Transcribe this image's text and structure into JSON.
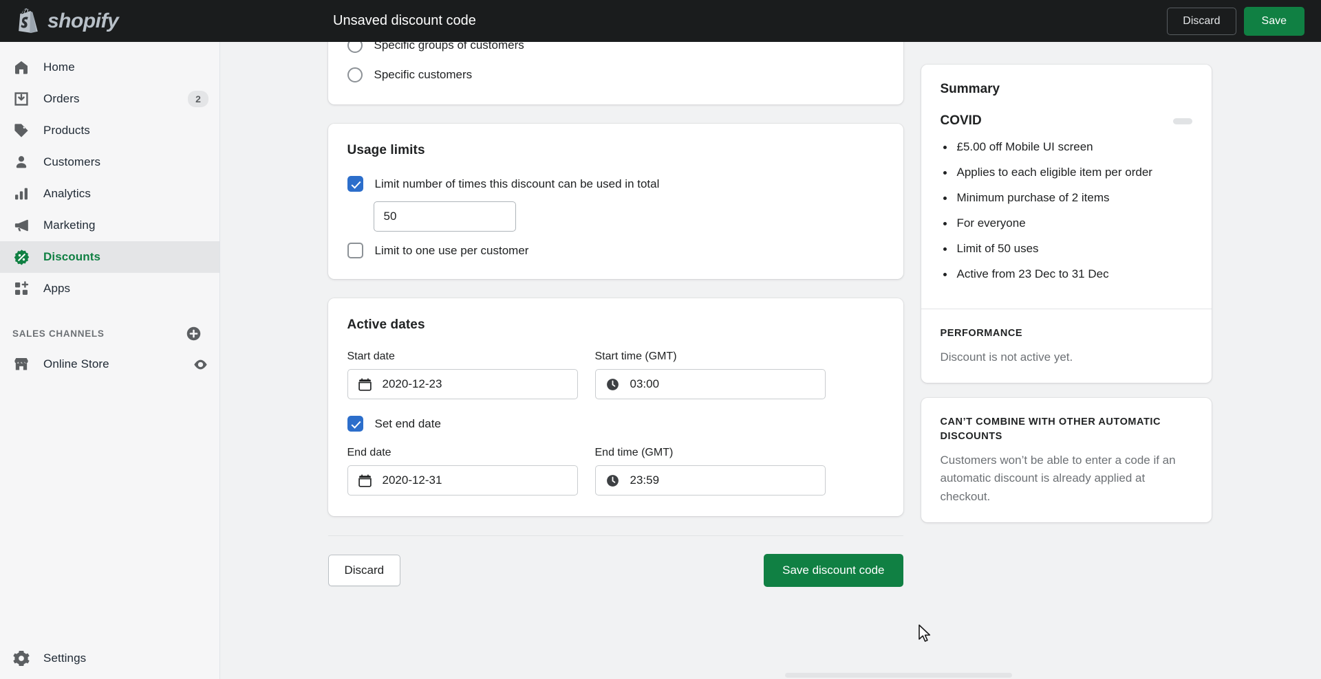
{
  "topbar": {
    "brand": "shopify",
    "brand_icon": "shopify-bag-logo",
    "title": "Unsaved discount code",
    "discard_label": "Discard",
    "save_label": "Save",
    "accent_green": "#108043",
    "background": "#1a1c1d"
  },
  "sidebar": {
    "items": [
      {
        "label": "Home",
        "icon": "home-icon",
        "badge": "",
        "active": false
      },
      {
        "label": "Orders",
        "icon": "orders-icon",
        "badge": "2",
        "active": false
      },
      {
        "label": "Products",
        "icon": "products-icon",
        "badge": "",
        "active": false
      },
      {
        "label": "Customers",
        "icon": "customers-icon",
        "badge": "",
        "active": false
      },
      {
        "label": "Analytics",
        "icon": "analytics-icon",
        "badge": "",
        "active": false
      },
      {
        "label": "Marketing",
        "icon": "marketing-icon",
        "badge": "",
        "active": false
      },
      {
        "label": "Discounts",
        "icon": "discounts-icon",
        "badge": "",
        "active": true
      },
      {
        "label": "Apps",
        "icon": "apps-icon",
        "badge": "",
        "active": false
      }
    ],
    "sales_channels": {
      "title": "SALES CHANNELS",
      "add_icon": "plus-circle-icon",
      "channels": [
        {
          "label": "Online Store",
          "icon": "store-icon",
          "action_icon": "eye-icon"
        }
      ]
    },
    "settings": {
      "label": "Settings",
      "icon": "gear-icon"
    },
    "active_color": "#108043"
  },
  "eligibility_card": {
    "options": [
      {
        "label": "Specific groups of customers",
        "selected": false
      },
      {
        "label": "Specific customers",
        "selected": false
      }
    ]
  },
  "usage_limits": {
    "title": "Usage limits",
    "limit_total": {
      "label": "Limit number of times this discount can be used in total",
      "checked": true,
      "value": "50",
      "placeholder": ""
    },
    "limit_per_customer": {
      "label": "Limit to one use per customer",
      "checked": false
    }
  },
  "active_dates": {
    "title": "Active dates",
    "start_date": {
      "label": "Start date",
      "value": "2020-12-23",
      "icon": "calendar-icon"
    },
    "start_time": {
      "label": "Start time (GMT)",
      "value": "03:00",
      "icon": "clock-icon"
    },
    "set_end_date": {
      "label": "Set end date",
      "checked": true
    },
    "end_date": {
      "label": "End date",
      "value": "2020-12-31",
      "icon": "calendar-icon"
    },
    "end_time": {
      "label": "End time (GMT)",
      "value": "23:59",
      "icon": "clock-icon"
    }
  },
  "footer": {
    "discard_label": "Discard",
    "save_label": "Save discount code"
  },
  "summary": {
    "title": "Summary",
    "code": "COVID",
    "bullets": [
      "£5.00 off Mobile UI screen",
      "Applies to each eligible item per order",
      "Minimum purchase of 2 items",
      "For everyone",
      "Limit of 50 uses",
      "Active from 23 Dec to 31 Dec"
    ],
    "performance": {
      "heading": "PERFORMANCE",
      "body": "Discount is not active yet."
    },
    "combine": {
      "heading": "CAN’T COMBINE WITH OTHER AUTOMATIC DISCOUNTS",
      "body": "Customers won’t be able to enter a code if an automatic discount is already applied at checkout."
    }
  },
  "colors": {
    "checkbox_blue": "#2c6ecb",
    "brand_green": "#108043",
    "page_bg": "#f1f2f3",
    "sidebar_bg": "#f6f6f7"
  }
}
